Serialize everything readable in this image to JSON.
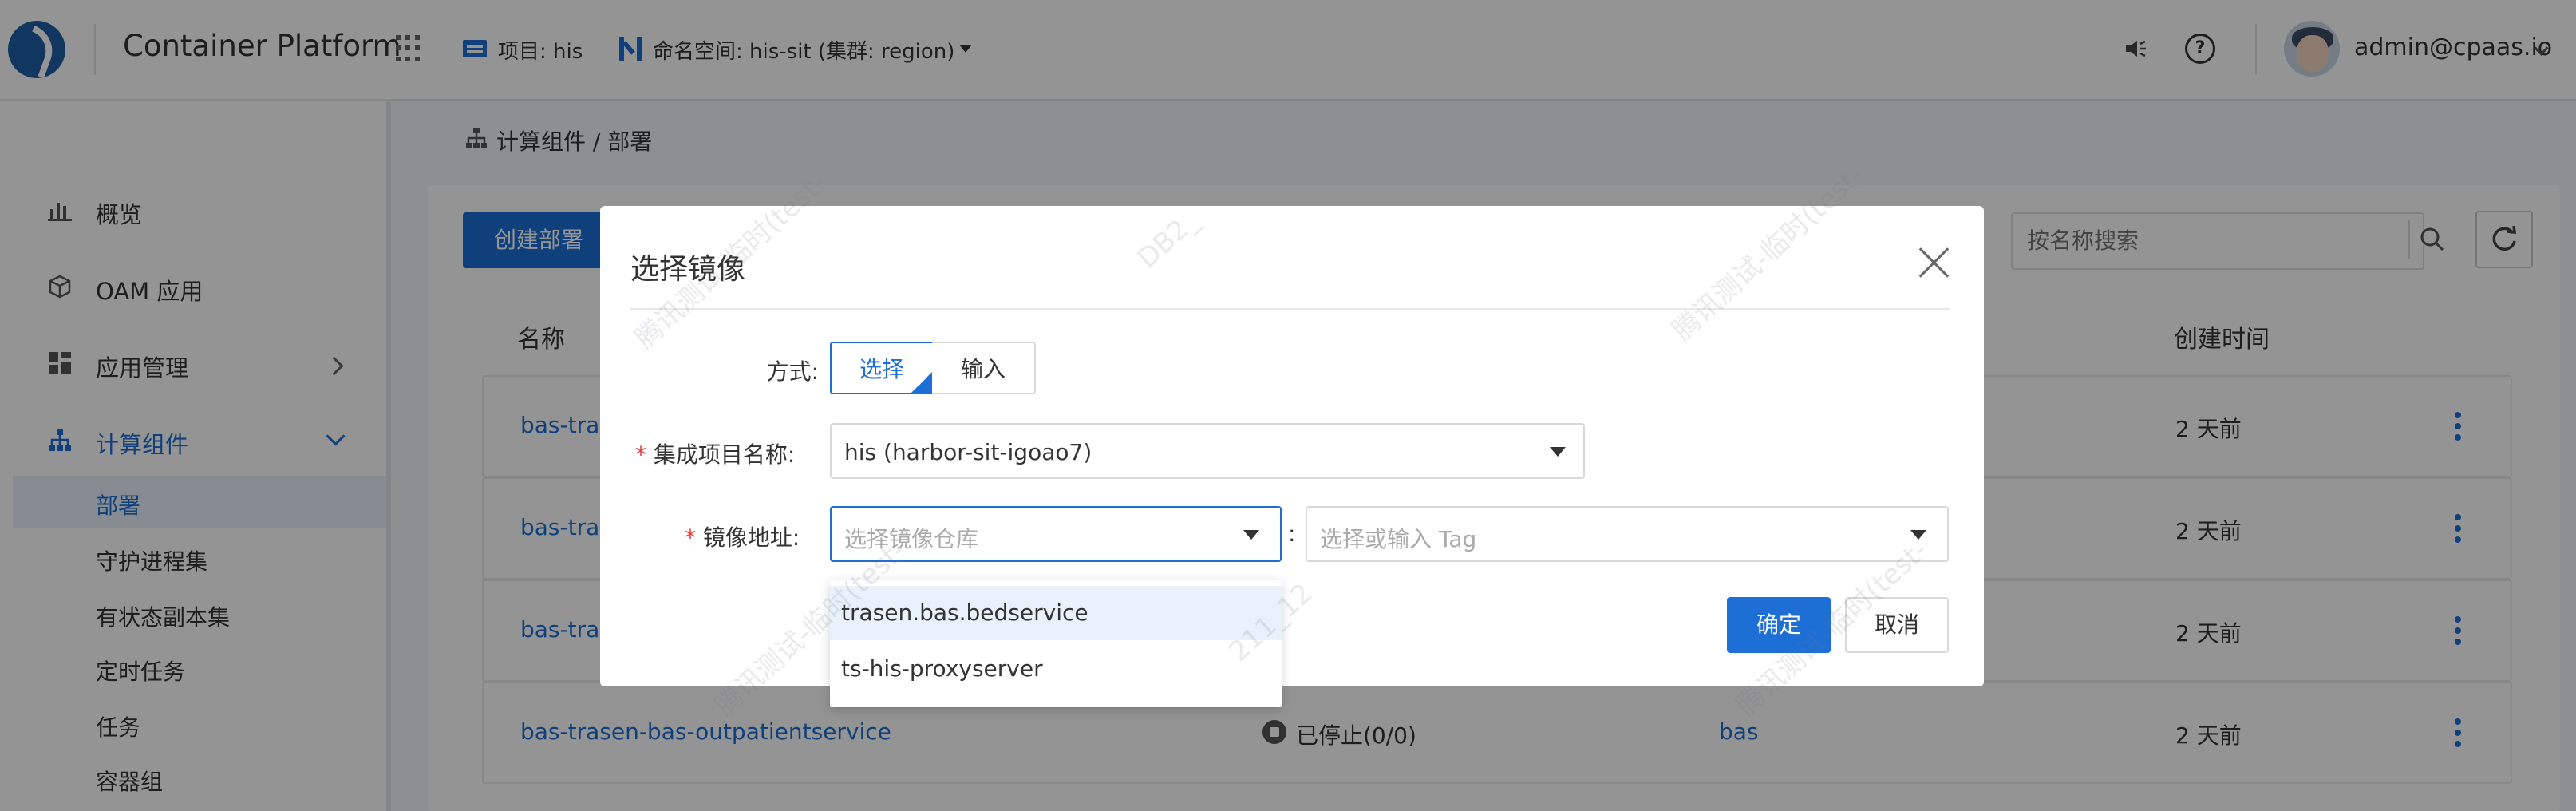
{
  "header": {
    "app_title": "Container Platform",
    "project_label": "项目: his",
    "namespace_label": "命名空间: his-sit (集群: region)",
    "user": "admin@cpaas.io"
  },
  "sidebar": {
    "items": [
      {
        "label": "概览",
        "icon": "bar-chart-icon"
      },
      {
        "label": "OAM 应用",
        "icon": "cube-icon"
      },
      {
        "label": "应用管理",
        "icon": "apps-grid-icon"
      },
      {
        "label": "计算组件",
        "icon": "topology-icon"
      }
    ],
    "sub_items": [
      "部署",
      "守护进程集",
      "有状态副本集",
      "定时任务",
      "任务",
      "容器组"
    ]
  },
  "breadcrumb": "计算组件 / 部署",
  "toolbar": {
    "create_label": "创建部署",
    "search_placeholder": "按名称搜索"
  },
  "table": {
    "headers": {
      "name": "名称",
      "created": "创建时间"
    },
    "rows": [
      {
        "name": "bas-tras",
        "status": "",
        "ns": "",
        "created": "2 天前"
      },
      {
        "name": "bas-tras",
        "status": "",
        "ns": "",
        "created": "2 天前"
      },
      {
        "name": "bas-tras",
        "status": "",
        "ns": "",
        "created": "2 天前"
      },
      {
        "name": "bas-trasen-bas-outpatientservice",
        "status": "已停止(0/0)",
        "ns": "bas",
        "created": "2 天前"
      }
    ]
  },
  "modal": {
    "title": "选择镜像",
    "mode_label": "方式:",
    "mode_options": [
      "选择",
      "输入"
    ],
    "project_label": "集成项目名称:",
    "project_value": "his (harbor-sit-igoao7)",
    "image_label": "镜像地址:",
    "repo_placeholder": "选择镜像仓库",
    "tag_placeholder": "选择或输入 Tag",
    "colon": ":",
    "options": [
      "trasen.bas.bedservice",
      "ts-his-proxyserver"
    ],
    "confirm_label": "确定",
    "cancel_label": "取消"
  },
  "watermark": [
    "腾讯测试-临时(test-",
    "DB2_",
    "211_12"
  ],
  "colors": {
    "primary": "#1d6fd6",
    "required": "#e84040"
  }
}
